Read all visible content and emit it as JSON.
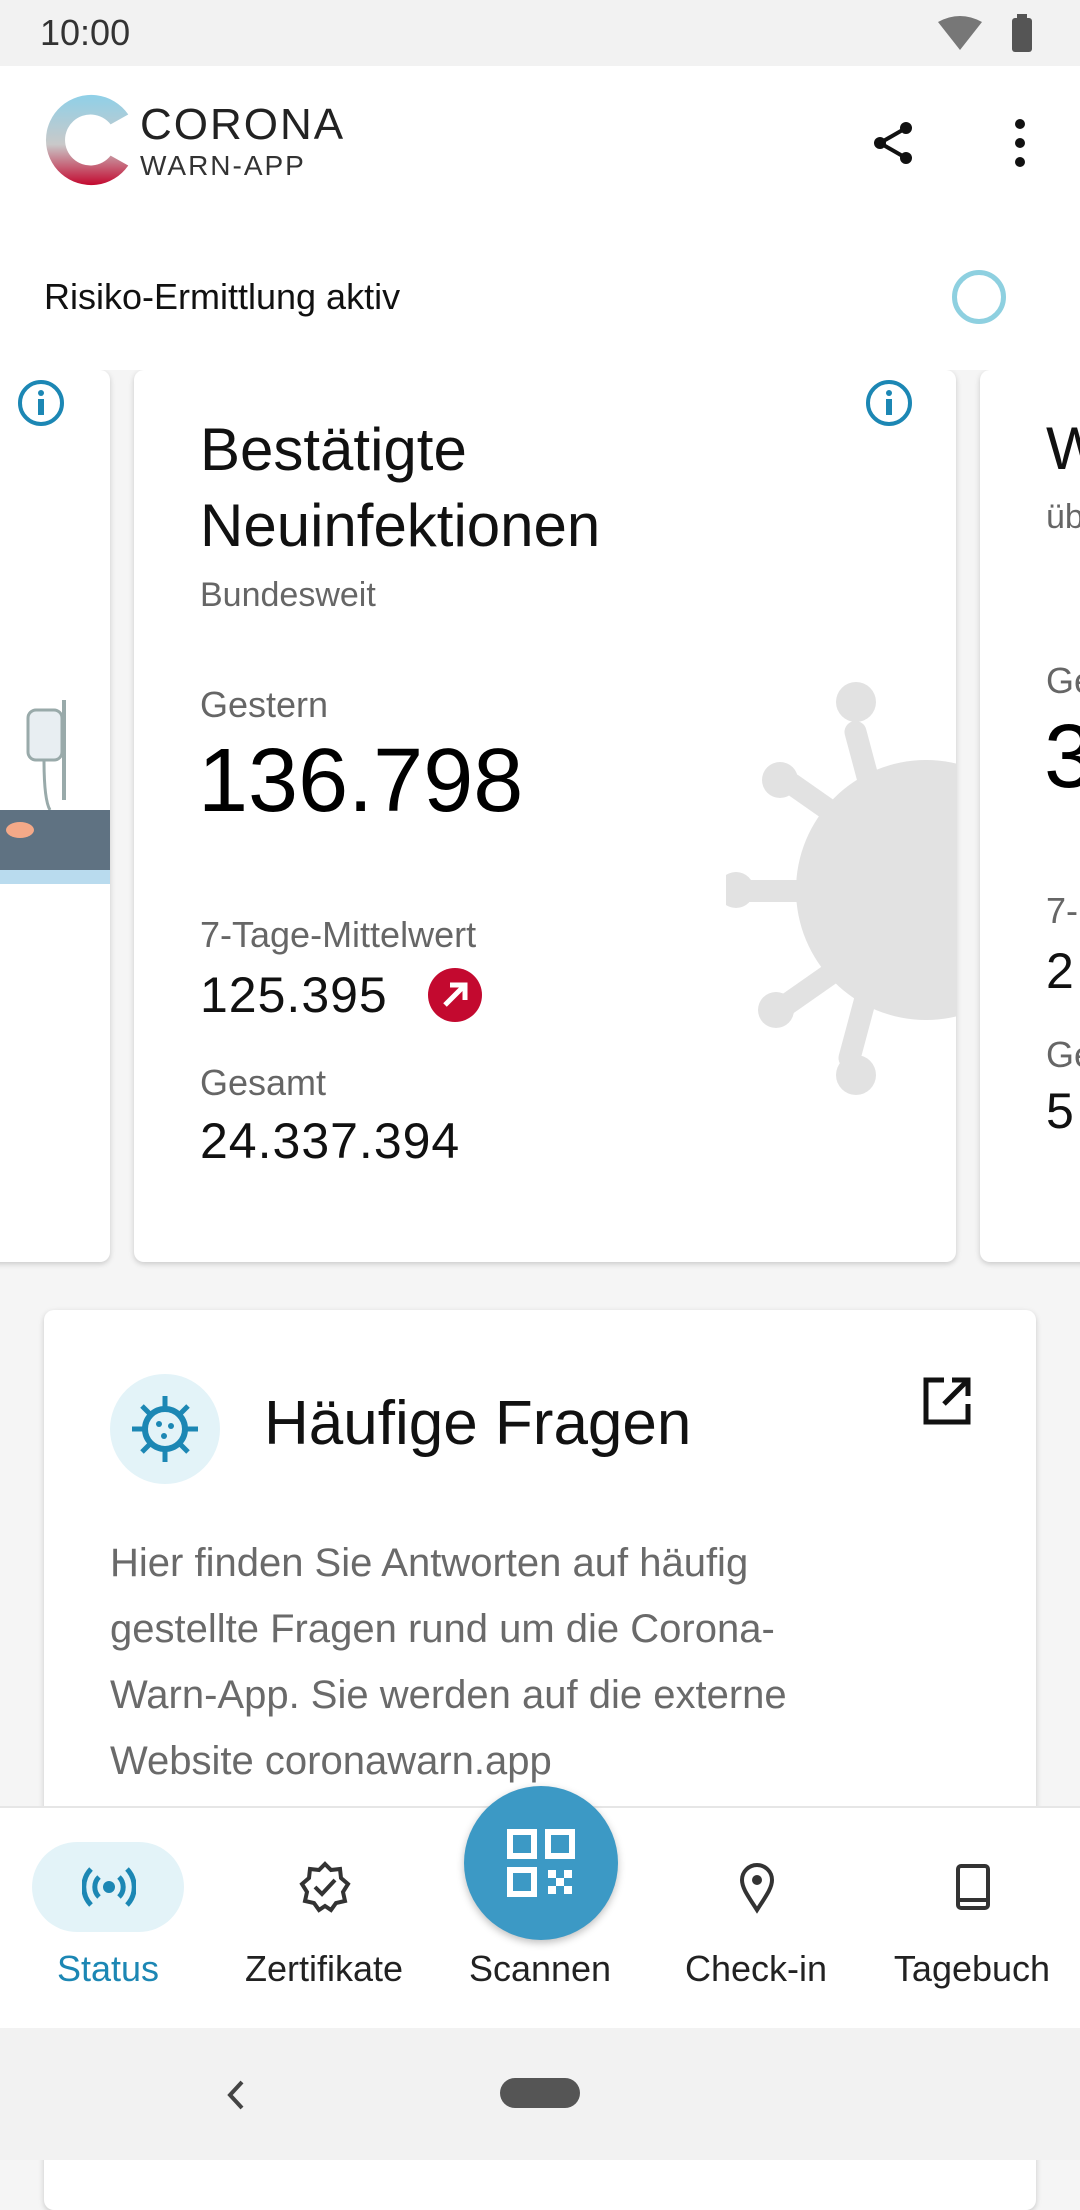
{
  "status_bar": {
    "time": "10:00"
  },
  "header": {
    "brand_name": "CORONA",
    "brand_sub": "WARN-APP",
    "risk_label": "Risiko-Ermittlung aktiv"
  },
  "cards": {
    "main": {
      "title_line1": "Bestätigte",
      "title_line2": "Neuinfektionen",
      "subtitle": "Bundesweit",
      "yesterday_label": "Gestern",
      "yesterday_value": "136.798",
      "avg_label": "7-Tage-Mittelwert",
      "avg_value": "125.395",
      "total_label": "Gesamt",
      "total_value": "24.337.394"
    },
    "right_peek": {
      "title": "W",
      "subtitle": "üb",
      "label1": "Ge",
      "value1": "3",
      "label2": "7-",
      "value2": "2",
      "label3": "Ge",
      "value3": "5"
    }
  },
  "faq": {
    "title": "Häufige Fragen",
    "text": "Hier finden Sie Antworten auf häufig gestellte Fragen rund um die Corona-Warn-App. Sie werden auf die externe Website coronawarn.app"
  },
  "nav": {
    "items": [
      {
        "label": "Status"
      },
      {
        "label": "Zertifikate"
      },
      {
        "label": "Scannen"
      },
      {
        "label": "Check-in"
      },
      {
        "label": "Tagebuch"
      }
    ]
  },
  "colors": {
    "accent": "#1c87b4",
    "fab": "#3c99c5",
    "trend_up": "#c3092f",
    "active_bg": "#e3f3f8"
  }
}
